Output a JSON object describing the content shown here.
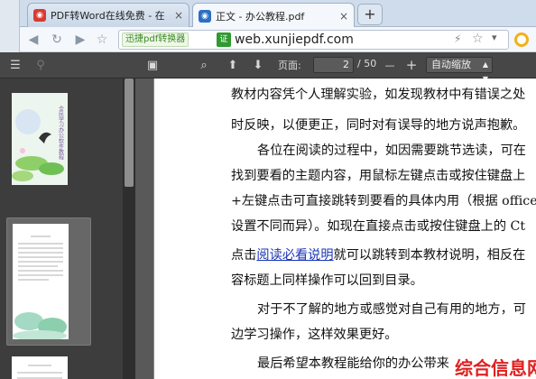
{
  "browser": {
    "tabs": [
      {
        "title": "PDF转Word在线免费 - 在",
        "close": "×",
        "favicon_color": "#d93a2f"
      },
      {
        "title": "正文 - 办公教程.pdf",
        "close": "×",
        "favicon_color": "#2a6fc2"
      }
    ],
    "new_tab": "+",
    "badge_label": "迅捷pdf转换器",
    "badge_icon_text": "证",
    "url": "web.xunjiepdf.com"
  },
  "pdf_toolbar": {
    "page_label": "页面:",
    "page_current": "2",
    "page_total": "/ 50",
    "zoom_out": "—",
    "zoom_in": "+",
    "zoom_value": "自动缩放"
  },
  "document": {
    "lines": [
      {
        "text": "教材内容凭个人理解实验，如发现教材中有错误之处",
        "indent": false
      },
      {
        "text": "时反映，以便更正，同时对有误导的地方说声抱歉。",
        "indent": false
      },
      {
        "text": "各位在阅读的过程中，如因需要跳节选读，可在",
        "indent": true
      },
      {
        "text": "找到要看的主题内容，用鼠标左键点击或按住键盘上",
        "indent": false
      },
      {
        "text": "+左键点击可直接跳转到要看的具体内用（根据 office",
        "indent": false
      },
      {
        "text": "设置不同而异）。如现在直接点击或按住键盘上的 Ct",
        "indent": false
      },
      {
        "text_before": "点击",
        "link": "阅读必看说明",
        "text_after": "就可以跳转到本教材说明，相反在",
        "indent": false
      },
      {
        "text": "容标题上同样操作可以回到目录。",
        "indent": false
      },
      {
        "text": "对于不了解的地方或感觉对自己有用的地方，可",
        "indent": true
      },
      {
        "text": "边学习操作，这样效果更好。",
        "indent": false
      },
      {
        "text": "最后希望本教程能给你的办公带来",
        "indent": true
      }
    ]
  },
  "thumbnail_text": "全民学习办公软件教程",
  "watermark": "综合信息网"
}
